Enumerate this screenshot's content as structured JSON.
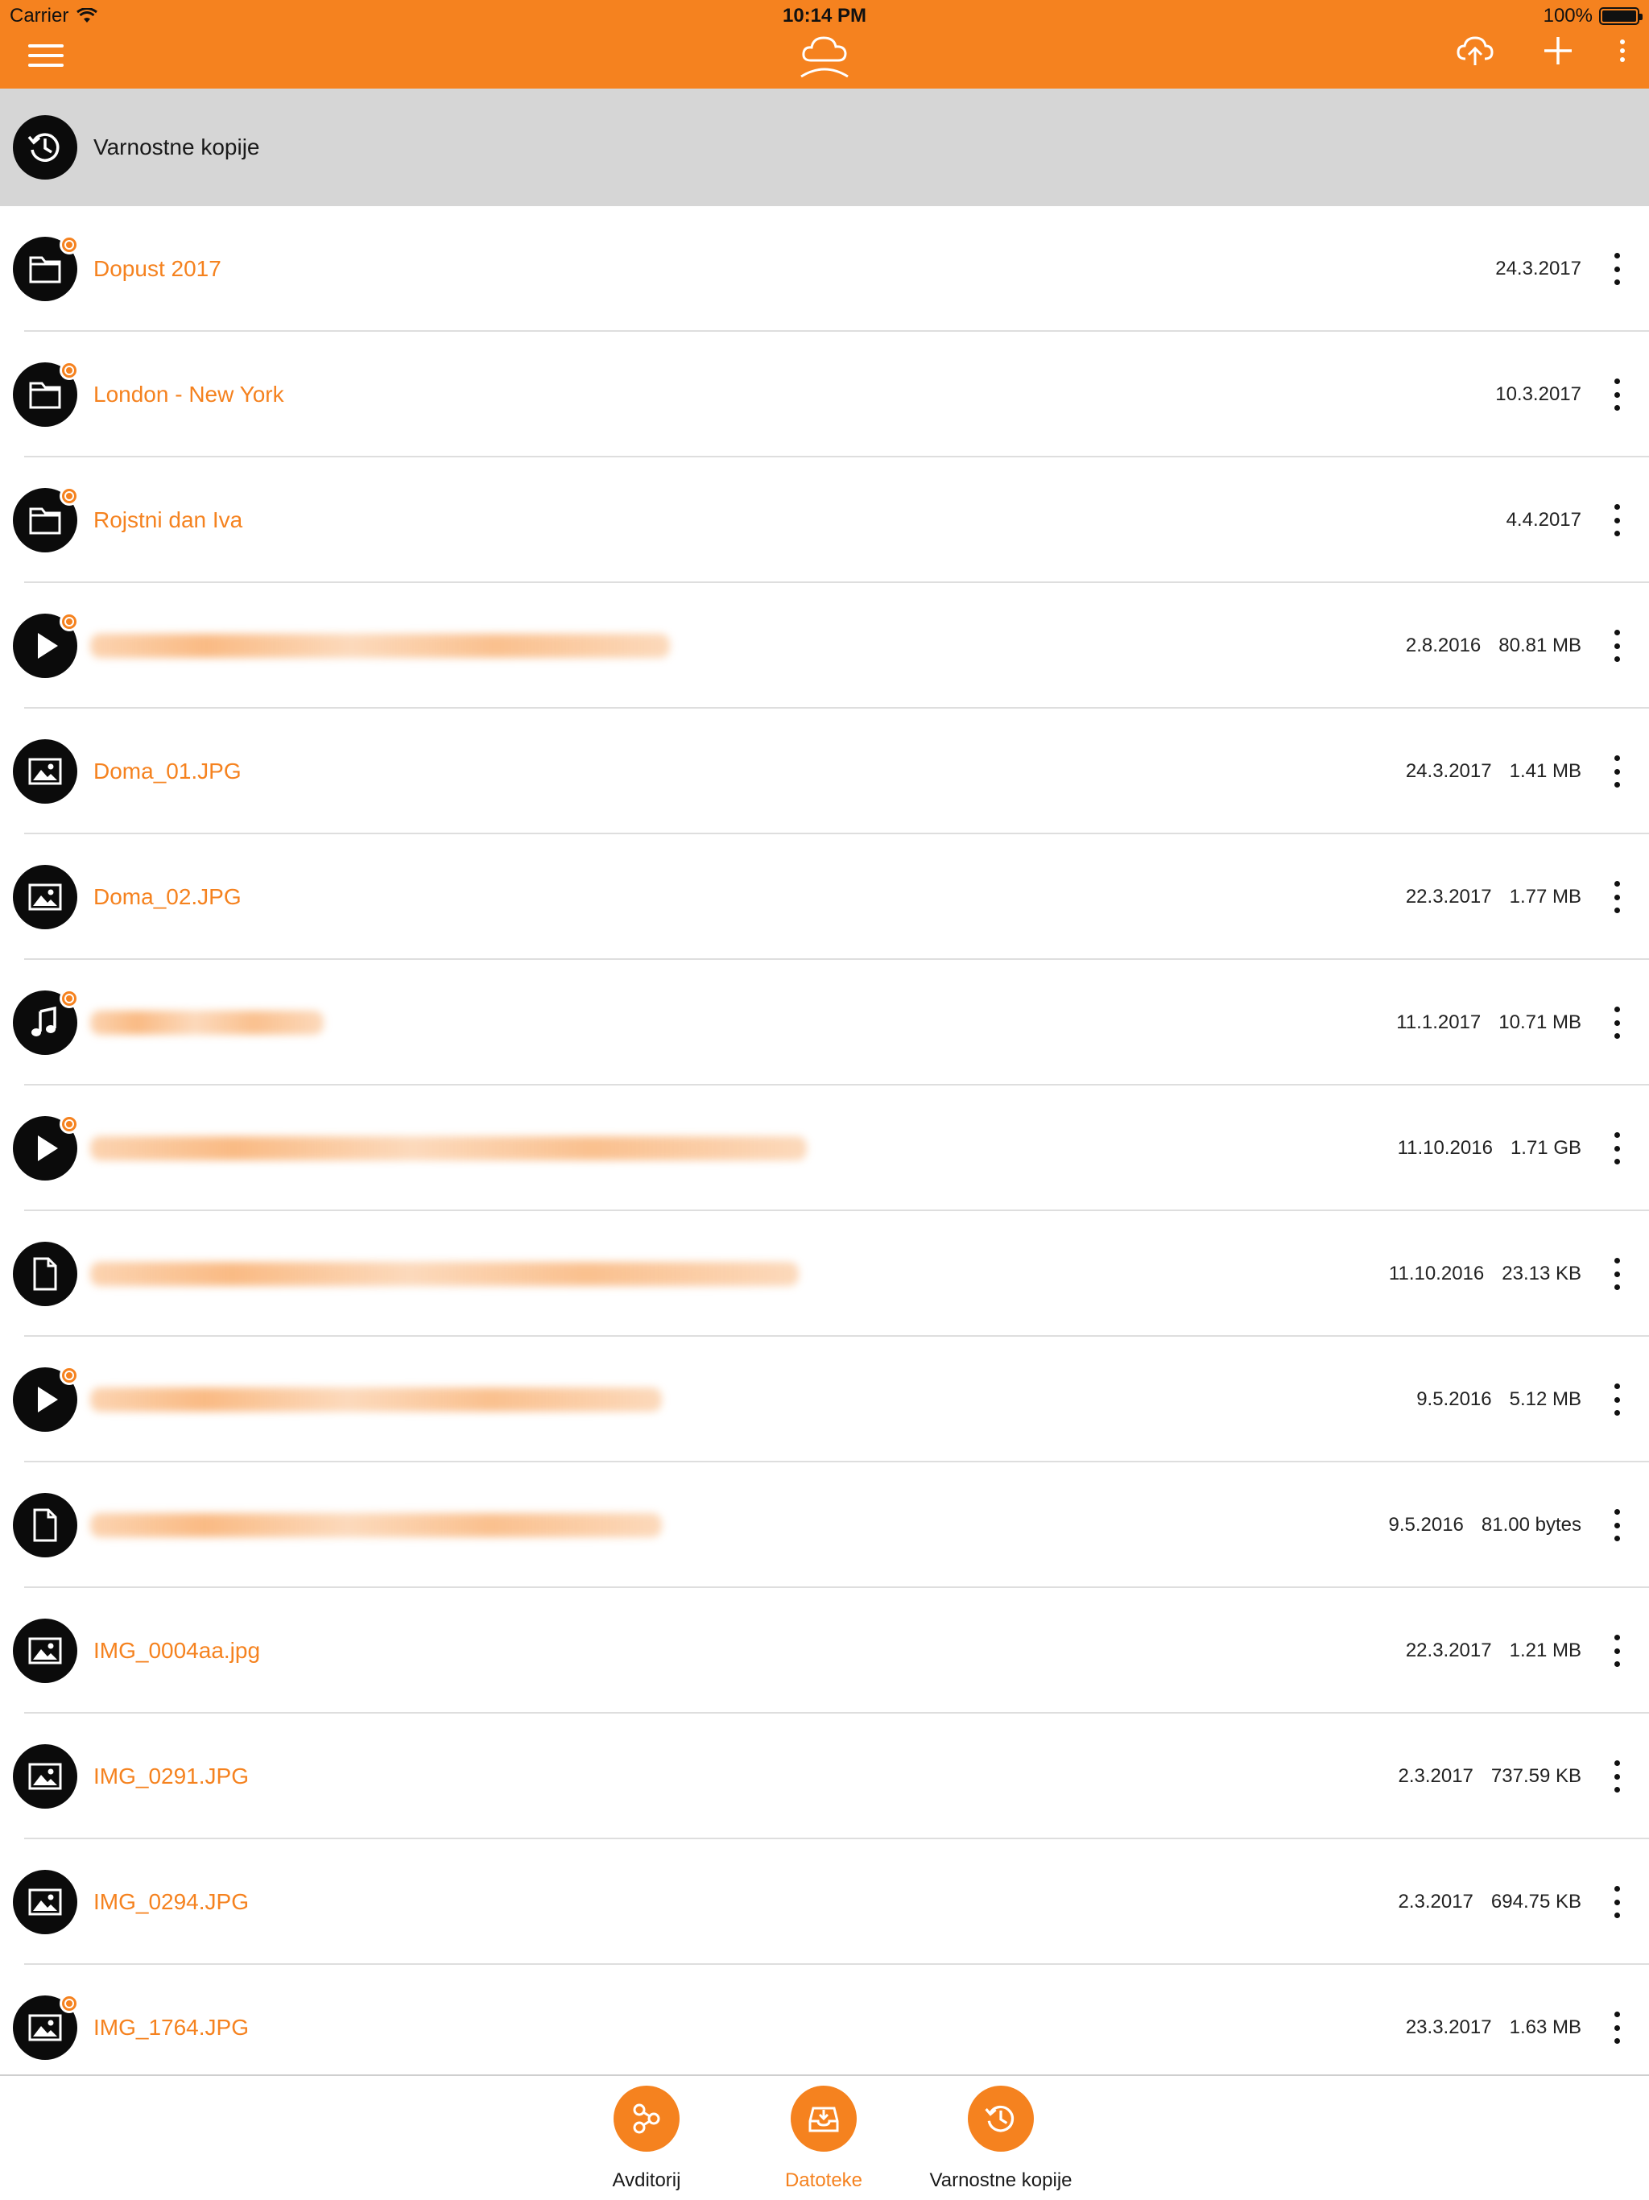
{
  "status_bar": {
    "carrier": "Carrier",
    "time": "10:14 PM",
    "battery": "100%"
  },
  "nav": {
    "menu_icon": "hamburger-menu-icon",
    "center_icon": "cloud-user-icon",
    "upload_icon": "cloud-upload-icon",
    "add_icon": "plus-icon",
    "more_icon": "vertical-dots-icon"
  },
  "backups_header": {
    "label": "Varnostne kopije",
    "icon": "history-icon"
  },
  "files": [
    {
      "type": "folder",
      "name": "Dopust 2017",
      "blurred": false,
      "date": "24.3.2017",
      "size": "",
      "shared": true
    },
    {
      "type": "folder",
      "name": "London - New York",
      "blurred": false,
      "date": "10.3.2017",
      "size": "",
      "shared": true
    },
    {
      "type": "folder",
      "name": "Rojstni dan Iva",
      "blurred": false,
      "date": "4.4.2017",
      "size": "",
      "shared": true
    },
    {
      "type": "video",
      "name": "",
      "blurred": true,
      "date": "2.8.2016",
      "size": "80.81 MB",
      "shared": true
    },
    {
      "type": "image",
      "name": "Doma_01.JPG",
      "blurred": false,
      "date": "24.3.2017",
      "size": "1.41 MB",
      "shared": false
    },
    {
      "type": "image",
      "name": "Doma_02.JPG",
      "blurred": false,
      "date": "22.3.2017",
      "size": "1.77 MB",
      "shared": false
    },
    {
      "type": "audio",
      "name": "",
      "blurred": true,
      "date": "11.1.2017",
      "size": "10.71 MB",
      "shared": true
    },
    {
      "type": "video",
      "name": "",
      "blurred": true,
      "date": "11.10.2016",
      "size": "1.71 GB",
      "shared": true
    },
    {
      "type": "document",
      "name": "",
      "blurred": true,
      "date": "11.10.2016",
      "size": "23.13 KB",
      "shared": false
    },
    {
      "type": "video",
      "name": "",
      "blurred": true,
      "date": "9.5.2016",
      "size": "5.12 MB",
      "shared": true
    },
    {
      "type": "document",
      "name": "",
      "blurred": true,
      "date": "9.5.2016",
      "size": "81.00 bytes",
      "shared": false
    },
    {
      "type": "image",
      "name": "IMG_0004aa.jpg",
      "blurred": false,
      "date": "22.3.2017",
      "size": "1.21 MB",
      "shared": false
    },
    {
      "type": "image",
      "name": "IMG_0291.JPG",
      "blurred": false,
      "date": "2.3.2017",
      "size": "737.59 KB",
      "shared": false
    },
    {
      "type": "image",
      "name": "IMG_0294.JPG",
      "blurred": false,
      "date": "2.3.2017",
      "size": "694.75 KB",
      "shared": false
    },
    {
      "type": "image",
      "name": "IMG_1764.JPG",
      "blurred": false,
      "date": "23.3.2017",
      "size": "1.63 MB",
      "shared": true
    }
  ],
  "tabs": [
    {
      "label": "Avditorij",
      "icon": "share-nodes-icon",
      "active": false
    },
    {
      "label": "Datoteke",
      "icon": "inbox-icon",
      "active": true
    },
    {
      "label": "Varnostne kopije",
      "icon": "history-icon",
      "active": false
    }
  ],
  "colors": {
    "accent": "#f5821f",
    "header_gray": "#d6d6d6",
    "icon_black": "#0b0b0b"
  }
}
